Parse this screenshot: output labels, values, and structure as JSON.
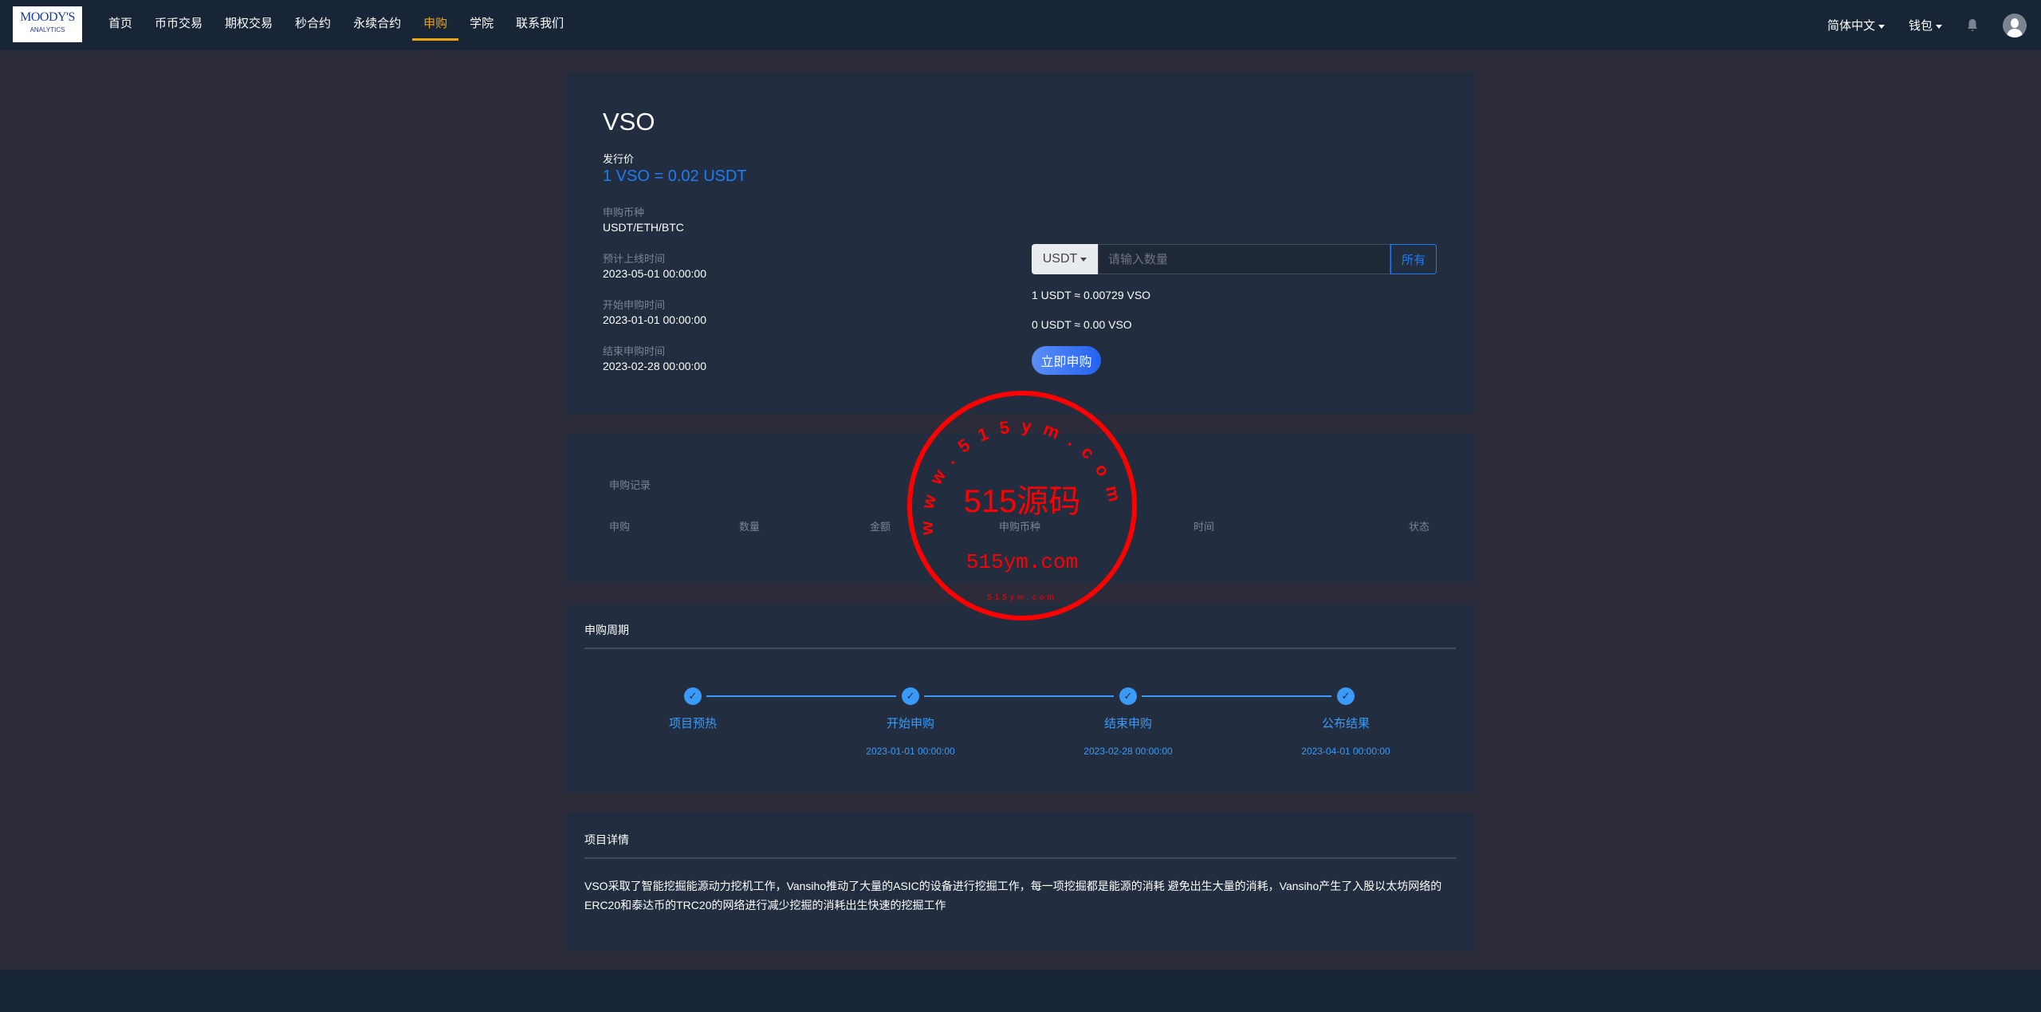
{
  "nav": {
    "logo": [
      "MOODY'S",
      "ANALYTICS"
    ],
    "items": [
      "首页",
      "币币交易",
      "期权交易",
      "秒合约",
      "永续合约",
      "申购",
      "学院",
      "联系我们"
    ],
    "active_index": 5,
    "language": "简体中文",
    "wallet": "钱包"
  },
  "project": {
    "name": "VSO",
    "price_label": "发行价",
    "price": "1 VSO = 0.02 USDT",
    "fields": [
      {
        "label": "申购币种",
        "value": "USDT/ETH/BTC"
      },
      {
        "label": "预计上线时间",
        "value": "2023-05-01 00:00:00"
      },
      {
        "label": "开始申购时间",
        "value": "2023-01-01 00:00:00"
      },
      {
        "label": "结束申购时间",
        "value": "2023-02-28 00:00:00"
      }
    ]
  },
  "form": {
    "currency": "USDT",
    "placeholder": "请输入数量",
    "all_label": "所有",
    "rate": "1 USDT ≈ 0.00729 VSO",
    "estimate": "0 USDT ≈ 0.00 VSO",
    "submit": "立即申购"
  },
  "records": {
    "title": "申购记录",
    "columns": [
      "申购",
      "数量",
      "金额",
      "申购币种",
      "时间",
      "状态"
    ]
  },
  "cycle": {
    "title": "申购周期",
    "steps": [
      {
        "label": "项目预热",
        "date": ""
      },
      {
        "label": "开始申购",
        "date": "2023-01-01 00:00:00"
      },
      {
        "label": "结束申购",
        "date": "2023-02-28 00:00:00"
      },
      {
        "label": "公布结果",
        "date": "2023-04-01 00:00:00"
      }
    ]
  },
  "details": {
    "title": "项目详情",
    "text": "VSO采取了智能挖掘能源动力挖机工作，Vansiho推动了大量的ASIC的设备进行挖掘工作，每一项挖掘都是能源的消耗 避免出生大量的消耗，Vansiho产生了入股以太坊网络的ERC20和泰达币的TRC20的网络进行减少挖掘的消耗出生快速的挖掘工作"
  },
  "watermark": {
    "ring": "www.515ym.com",
    "main": "515源码",
    "url": "515ym.com",
    "bottom": "515ym.com"
  },
  "colors": {
    "accent": "#f0a40c",
    "blue": "#1e7cf2",
    "step": "#3a9af7",
    "stamp": "#ff0000"
  }
}
